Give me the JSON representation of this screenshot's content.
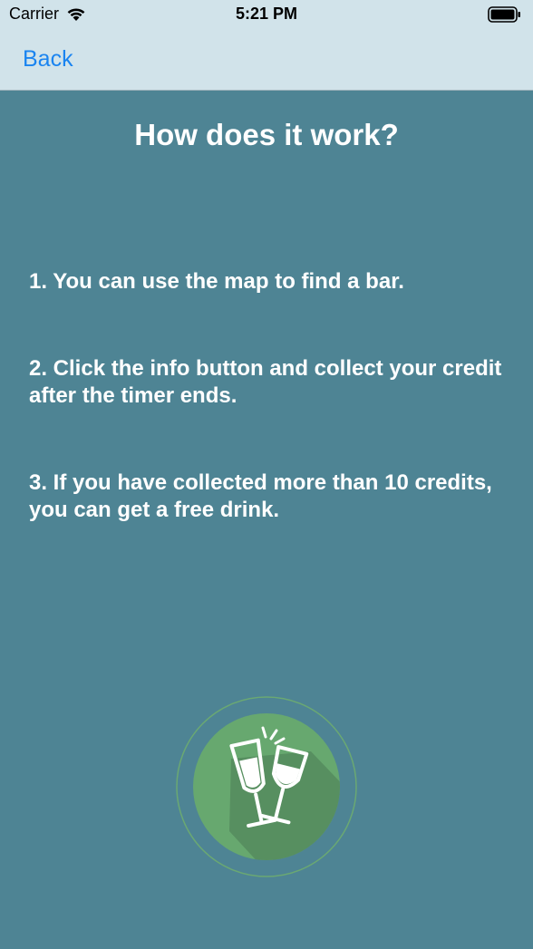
{
  "status_bar": {
    "carrier": "Carrier",
    "time": "5:21 PM",
    "wifi_icon": "wifi-icon",
    "battery_icon": "battery-icon"
  },
  "nav": {
    "back_label": "Back"
  },
  "main": {
    "title": "How does it work?",
    "steps": [
      "1. You can use the map to find a bar.",
      "2. Click the info button and collect your credit after the timer ends.",
      "3. If you have collected more than 10 credits, you can get a free drink."
    ],
    "logo_icon": "cheers-glasses-icon"
  },
  "colors": {
    "background": "#4e8494",
    "header": "#d1e3ea",
    "accent": "#1a84f0",
    "logo_green": "#67a86f"
  }
}
